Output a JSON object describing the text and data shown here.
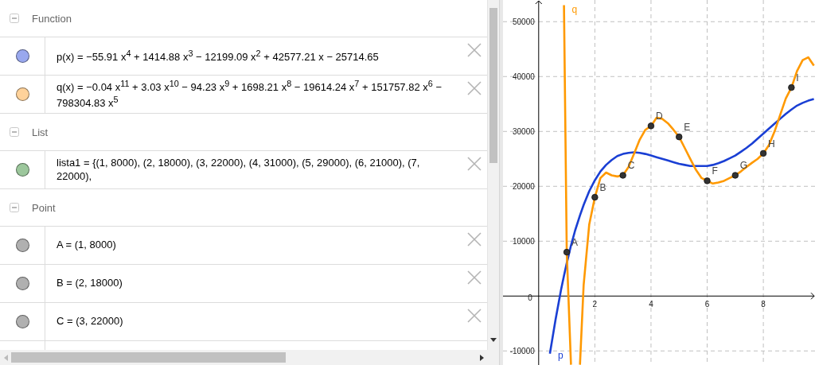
{
  "algebra": {
    "groups": [
      {
        "title": "Function",
        "expanded": true,
        "items": [
          {
            "text": "p(x) = −55.91 x$^{4}$ + 1414.88 x$^{3}$ − 12199.09 x$^{2}$ + 42577.21 x − 25714.65",
            "color": "#99a8ee"
          },
          {
            "text": "q(x) = −0.04 x$^{11}$ + 3.03 x$^{10}$ − 94.23 x$^{9}$ + 1698.21 x$^{8}$ − 19614.24 x$^{7}$ + 151757.82 x$^{6}$ − 798304.83 x$^{5}$",
            "color": "#ffd29a"
          }
        ]
      },
      {
        "title": "List",
        "expanded": true,
        "items": [
          {
            "text": "lista1 = {(1, 8000), (2, 18000), (3, 22000), (4, 31000), (5, 29000), (6, 21000), (7, 22000),",
            "color": "#9cc79c"
          }
        ]
      },
      {
        "title": "Point",
        "expanded": true,
        "items": [
          {
            "text": "A = (1, 8000)",
            "color": "#b0b0b0"
          },
          {
            "text": "B = (2, 18000)",
            "color": "#b0b0b0"
          },
          {
            "text": "C = (3, 22000)",
            "color": "#b0b0b0"
          }
        ]
      }
    ]
  },
  "graphics": {
    "chart_data": {
      "type": "line",
      "x": [
        0.4,
        0.6,
        0.8,
        0.9,
        1.0,
        1.15,
        1.3,
        1.47,
        1.6,
        1.8,
        2.0,
        2.2,
        2.4,
        2.6,
        2.8,
        3.0,
        3.2,
        3.4,
        3.6,
        3.8,
        4.0,
        4.2,
        4.4,
        4.6,
        4.8,
        5.0,
        5.2,
        5.4,
        5.6,
        5.8,
        6.0,
        6.2,
        6.4,
        6.6,
        6.8,
        7.0,
        7.2,
        7.4,
        7.6,
        7.8,
        8.0,
        8.2,
        8.4,
        8.6,
        8.8,
        9.0,
        9.2,
        9.4,
        9.6,
        9.8
      ],
      "series": [
        {
          "name": "p",
          "color": "#1a3fd4",
          "values": [
            -10500,
            -4300,
            1200,
            3700,
            6000,
            9200,
            12000,
            14700,
            16600,
            19100,
            21100,
            22700,
            23900,
            24800,
            25500,
            25900,
            26100,
            26200,
            26100,
            25900,
            25600,
            25300,
            25000,
            24700,
            24400,
            24100,
            23900,
            23700,
            23700,
            23700,
            23700,
            23900,
            24200,
            24600,
            25100,
            25600,
            26300,
            27000,
            27800,
            28700,
            29600,
            30500,
            31400,
            32300,
            33200,
            34000,
            34700,
            35200,
            35600,
            35900
          ]
        },
        {
          "name": "q",
          "color": "#ff9900",
          "values": [
            null,
            null,
            null,
            53000,
            8000,
            -12500,
            null,
            -12500,
            2000,
            13000,
            18000,
            21500,
            22500,
            22000,
            21800,
            22000,
            23500,
            26000,
            28500,
            30300,
            31000,
            32500,
            32300,
            31500,
            30300,
            29000,
            27000,
            25000,
            23000,
            21500,
            21000,
            20500,
            20700,
            21000,
            21500,
            22000,
            22700,
            23500,
            24300,
            25000,
            26000,
            27500,
            30000,
            33000,
            36000,
            38000,
            41000,
            43000,
            43500,
            42000
          ]
        }
      ],
      "annotations": [
        {
          "text": "A",
          "x": 1,
          "y": 8000
        },
        {
          "text": "B",
          "x": 2,
          "y": 18000
        },
        {
          "text": "C",
          "x": 3,
          "y": 22000
        },
        {
          "text": "D",
          "x": 4,
          "y": 31000
        },
        {
          "text": "E",
          "x": 5,
          "y": 29000
        },
        {
          "text": "F",
          "x": 6,
          "y": 21000
        },
        {
          "text": "G",
          "x": 7,
          "y": 22000
        },
        {
          "text": "H",
          "x": 8,
          "y": 26000
        },
        {
          "text": "I",
          "x": 9,
          "y": 38000
        }
      ],
      "grid": true,
      "xlim": [
        -1.27,
        9.84
      ],
      "ylim": [
        -12565,
        53950
      ],
      "xticks": [
        2,
        4,
        6,
        8
      ],
      "yticks": [
        -10000,
        {
          "value": 0,
          "label": "0"
        },
        10000,
        20000,
        30000,
        40000,
        50000
      ]
    }
  }
}
